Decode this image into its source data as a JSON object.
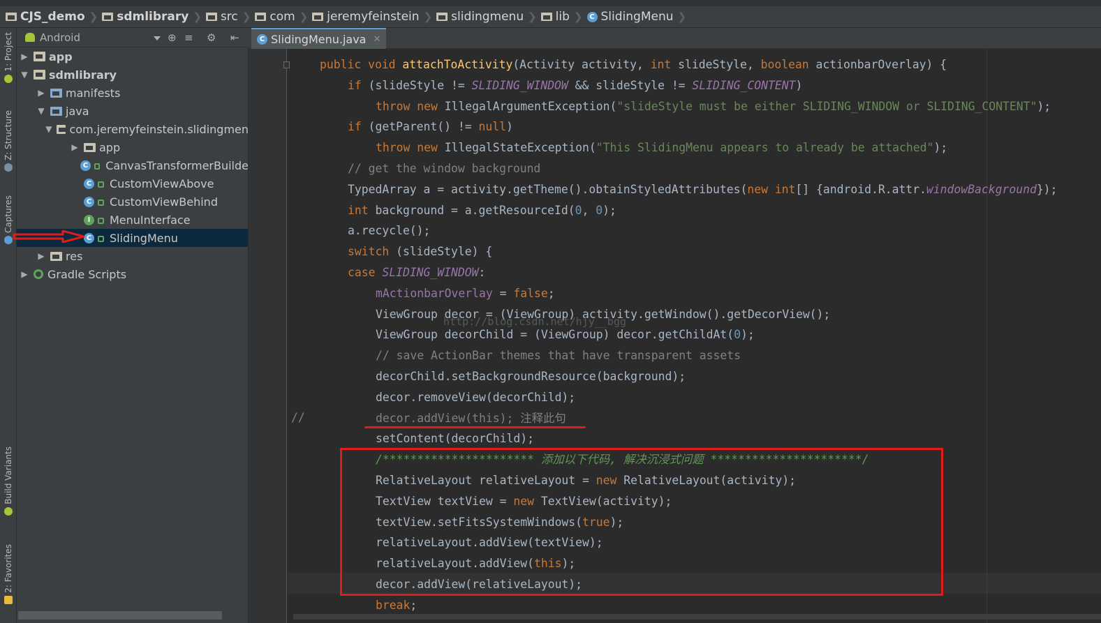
{
  "breadcrumb": {
    "items": [
      "CJS_demo",
      "sdmlibrary",
      "src",
      "com",
      "jeremyfeinstein",
      "slidingmenu",
      "lib",
      "SlidingMenu"
    ]
  },
  "side_tabs": {
    "project": "1: Project",
    "structure": "Z: Structure",
    "captures": "Captures",
    "build_variants": "Build Variants",
    "favorites": "2: Favorites"
  },
  "project_panel": {
    "view_selector": "Android",
    "tree": [
      {
        "label": "app"
      },
      {
        "label": "sdmlibrary"
      },
      {
        "label": "manifests"
      },
      {
        "label": "java"
      },
      {
        "label": "com.jeremyfeinstein.slidingmen"
      },
      {
        "label": "app"
      },
      {
        "label": "CanvasTransformerBuilde"
      },
      {
        "label": "CustomViewAbove"
      },
      {
        "label": "CustomViewBehind"
      },
      {
        "label": "MenuInterface"
      },
      {
        "label": "SlidingMenu"
      },
      {
        "label": "res"
      },
      {
        "label": "Gradle Scripts"
      }
    ]
  },
  "editor": {
    "tab_label": "SlidingMenu.java",
    "watermark": "http://blog.csdn.net/hjy__bgg",
    "line_comment_marker": "//",
    "code_lines": [
      [
        [
          "kw",
          "public "
        ],
        [
          "kw",
          "void "
        ],
        [
          "fn",
          "attachToActivity"
        ],
        [
          "plain",
          "(Activity activity, "
        ],
        [
          "kw",
          "int "
        ],
        [
          "plain",
          "slideStyle, "
        ],
        [
          "kw",
          "boolean "
        ],
        [
          "plain",
          "actionbarOverlay) {"
        ]
      ],
      [
        [
          "kw",
          "if "
        ],
        [
          "plain",
          "(slideStyle != "
        ],
        [
          "cst",
          "SLIDING_WINDOW"
        ],
        [
          "plain",
          " && slideStyle != "
        ],
        [
          "cst",
          "SLIDING_CONTENT"
        ],
        [
          "plain",
          ")"
        ]
      ],
      [
        [
          "kw",
          "throw new "
        ],
        [
          "plain",
          "IllegalArgumentException("
        ],
        [
          "str",
          "\"slideStyle must be either SLIDING_WINDOW or SLIDING_CONTENT\""
        ],
        [
          "plain",
          ");"
        ]
      ],
      [
        [
          "kw",
          "if "
        ],
        [
          "plain",
          "(getParent() != "
        ],
        [
          "kw",
          "null"
        ],
        [
          "plain",
          ")"
        ]
      ],
      [
        [
          "kw",
          "throw new "
        ],
        [
          "plain",
          "IllegalStateException("
        ],
        [
          "str",
          "\"This SlidingMenu appears to already be attached\""
        ],
        [
          "plain",
          ");"
        ]
      ],
      [
        [
          "cmt",
          "// get the window background"
        ]
      ],
      [
        [
          "plain",
          "TypedArray a = activity.getTheme().obtainStyledAttributes("
        ],
        [
          "kw",
          "new int"
        ],
        [
          "plain",
          "[] {android.R.attr."
        ],
        [
          "cst",
          "windowBackground"
        ],
        [
          "plain",
          "});"
        ]
      ],
      [
        [
          "kw",
          "int "
        ],
        [
          "plain",
          "background = a.getResourceId("
        ],
        [
          "num",
          "0"
        ],
        [
          "plain",
          ", "
        ],
        [
          "num",
          "0"
        ],
        [
          "plain",
          ");"
        ]
      ],
      [
        [
          "plain",
          "a.recycle();"
        ]
      ],
      [
        [
          "kw",
          "switch "
        ],
        [
          "plain",
          "(slideStyle) {"
        ]
      ],
      [
        [
          "kw",
          "case "
        ],
        [
          "cst",
          "SLIDING_WINDOW"
        ],
        [
          "plain",
          ":"
        ]
      ],
      [
        [
          "fld",
          "mActionbarOverlay"
        ],
        [
          "plain",
          " = "
        ],
        [
          "kw",
          "false"
        ],
        [
          "plain",
          ";"
        ]
      ],
      [
        [
          "plain",
          "ViewGroup decor = (ViewGroup) activity.getWindow().getDecorView();"
        ]
      ],
      [
        [
          "plain",
          "ViewGroup decorChild = (ViewGroup) decor.getChildAt("
        ],
        [
          "num",
          "0"
        ],
        [
          "plain",
          ");"
        ]
      ],
      [
        [
          "cmt",
          "// save ActionBar themes that have transparent assets"
        ]
      ],
      [
        [
          "plain",
          "decorChild.setBackgroundResource(background);"
        ]
      ],
      [
        [
          "plain",
          "decor.removeView(decorChild);"
        ]
      ],
      [
        [
          "cmt",
          "decor.addView(this); 注释此句"
        ]
      ],
      [
        [
          "plain",
          "setContent(decorChild);"
        ]
      ],
      [
        [
          "cmtg",
          "/********************** 添加以下代码, 解决沉浸式问题 **********************/"
        ]
      ],
      [
        [
          "plain",
          "RelativeLayout relativeLayout = "
        ],
        [
          "kw",
          "new "
        ],
        [
          "plain",
          "RelativeLayout(activity);"
        ]
      ],
      [
        [
          "plain",
          "TextView textView = "
        ],
        [
          "kw",
          "new "
        ],
        [
          "plain",
          "TextView(activity);"
        ]
      ],
      [
        [
          "plain",
          "textView.setFitsSystemWindows("
        ],
        [
          "kw",
          "true"
        ],
        [
          "plain",
          ");"
        ]
      ],
      [
        [
          "plain",
          "relativeLayout.addView(textView);"
        ]
      ],
      [
        [
          "plain",
          "relativeLayout.addView("
        ],
        [
          "kw",
          "this"
        ],
        [
          "plain",
          ");"
        ]
      ],
      [
        [
          "plain",
          "decor.addView(relativeLayout);"
        ]
      ],
      [
        [
          "kw",
          "break"
        ],
        [
          "plain",
          ";"
        ]
      ]
    ]
  },
  "colors": {
    "accent": "#5c9fd6",
    "annotation_red": "#e11a1a",
    "selection": "#0d293e"
  }
}
